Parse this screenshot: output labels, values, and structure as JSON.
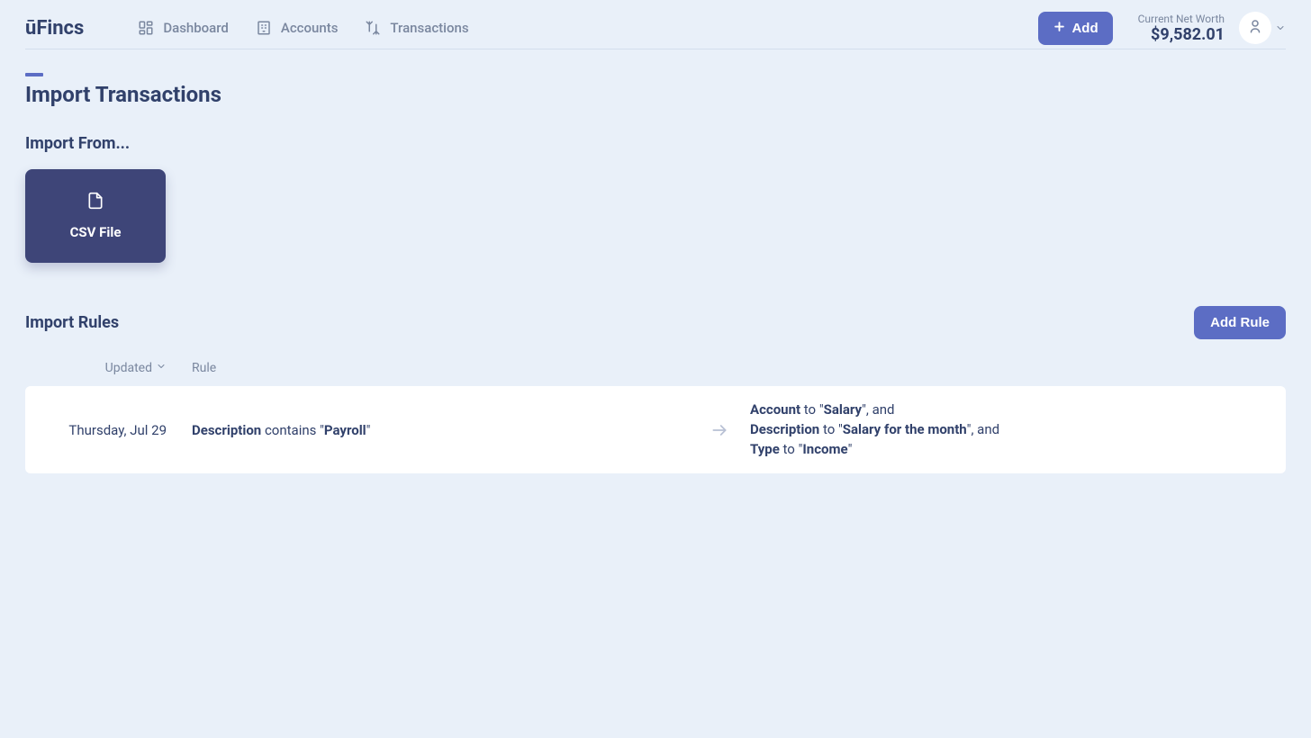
{
  "header": {
    "logo": "ūFincs",
    "nav": {
      "dashboard": "Dashboard",
      "accounts": "Accounts",
      "transactions": "Transactions"
    },
    "add_label": "Add",
    "networth_label": "Current Net Worth",
    "networth_value": "$9,582.01"
  },
  "page": {
    "title": "Import Transactions",
    "import_from_heading": "Import From...",
    "csv_card_label": "CSV File",
    "import_rules_heading": "Import Rules",
    "add_rule_label": "Add Rule"
  },
  "table": {
    "columns": {
      "updated": "Updated",
      "rule": "Rule"
    },
    "rows": [
      {
        "updated": "Thursday, Jul 29",
        "condition": {
          "field": "Description",
          "operator": "contains",
          "value": "Payroll"
        },
        "actions": [
          {
            "field": "Account",
            "verb": "to",
            "value": "Salary",
            "suffix": ", and"
          },
          {
            "field": "Description",
            "verb": "to",
            "value": "Salary for the month",
            "suffix": ", and"
          },
          {
            "field": "Type",
            "verb": "to",
            "value": "Income",
            "suffix": ""
          }
        ]
      }
    ]
  }
}
